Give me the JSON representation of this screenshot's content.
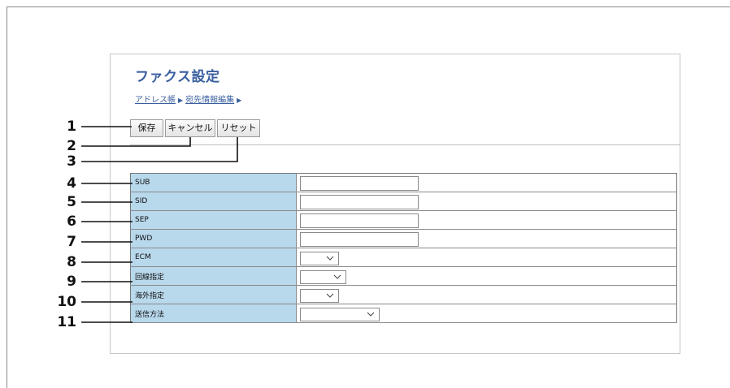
{
  "page": {
    "title": "ファクス設定",
    "breadcrumb": {
      "items": [
        "アドレス帳",
        "宛先情報編集"
      ],
      "separator": "▶"
    }
  },
  "toolbar": {
    "save_label": "保存",
    "cancel_label": "キャンセル",
    "reset_label": "リセット"
  },
  "settings": {
    "rows": [
      {
        "label": "SUB",
        "type": "text",
        "value": ""
      },
      {
        "label": "SID",
        "type": "text",
        "value": ""
      },
      {
        "label": "SEP",
        "type": "text",
        "value": ""
      },
      {
        "label": "PWD",
        "type": "text",
        "value": ""
      },
      {
        "label": "ECM",
        "type": "select",
        "value": ""
      },
      {
        "label": "回線指定",
        "type": "select",
        "value": ""
      },
      {
        "label": "海外指定",
        "type": "select",
        "value": ""
      },
      {
        "label": "送信方法",
        "type": "select",
        "value": ""
      }
    ]
  },
  "callouts": [
    "1",
    "2",
    "3",
    "4",
    "5",
    "6",
    "7",
    "8",
    "9",
    "10",
    "11"
  ],
  "colors": {
    "title": "#3a5fa0",
    "label_bg": "#b8d8ec",
    "callout_line": "#111111"
  }
}
